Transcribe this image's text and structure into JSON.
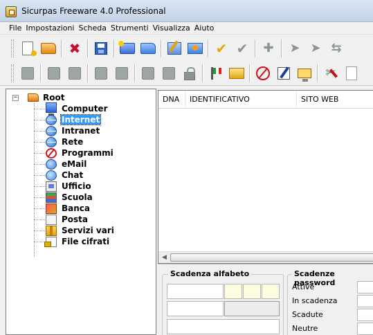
{
  "window": {
    "title": "Sicurpas Freeware 4.0 Professional"
  },
  "menu": {
    "items": [
      "File",
      "Impostazioni",
      "Scheda",
      "Strumenti",
      "Visualizza",
      "Aiuto"
    ]
  },
  "toolbar1": {
    "icons": [
      "new-document-icon",
      "open-folder-icon",
      "delete-icon",
      "save-icon",
      "folder-star-icon",
      "folder-open-icon",
      "edit-icon",
      "folder-move-icon",
      "check-icon",
      "check-disabled-icon",
      "arrows-disabled-icon",
      "arrow-disabled-icon",
      "arrow-disabled-icon",
      "arrow-disabled-icon"
    ]
  },
  "toolbar2": {
    "icons": [
      "disabled-icon",
      "disabled-icon",
      "disabled-icon",
      "disabled-icon",
      "disabled-icon",
      "disabled-icon",
      "disabled-icon",
      "lock-disabled-icon",
      "flag-icon",
      "folder-key-icon",
      "no-entry-icon",
      "edit-pen-icon",
      "monitor-icon",
      "tools-icon",
      "blank-doc-icon"
    ]
  },
  "tree": {
    "root_label": "Root",
    "toggle": "−",
    "items": [
      {
        "label": "Computer",
        "icon": "computer-icon"
      },
      {
        "label": "Internet",
        "icon": "globe-icon",
        "selected": true
      },
      {
        "label": "Intranet",
        "icon": "globe-icon"
      },
      {
        "label": "Rete",
        "icon": "globe-icon"
      },
      {
        "label": "Programmi",
        "icon": "programs-icon"
      },
      {
        "label": "eMail",
        "icon": "email-icon"
      },
      {
        "label": "Chat",
        "icon": "chat-icon"
      },
      {
        "label": "Ufficio",
        "icon": "office-icon"
      },
      {
        "label": "Scuola",
        "icon": "school-icon"
      },
      {
        "label": "Banca",
        "icon": "bank-icon"
      },
      {
        "label": "Posta",
        "icon": "post-icon"
      },
      {
        "label": "Servizi vari",
        "icon": "misc-services-icon"
      },
      {
        "label": "File cifrati",
        "icon": "encrypted-file-icon"
      }
    ]
  },
  "list": {
    "columns": [
      "DNA",
      "IDENTIFICATIVO",
      "SITO WEB"
    ],
    "scroll_left_glyph": "◀"
  },
  "scadenza_alfabeto": {
    "title": "Scadenza alfabeto"
  },
  "scadenze_password": {
    "title": "Scadenze password",
    "labels": [
      "Attive",
      "In scadenza",
      "Scadute",
      "Neutre"
    ]
  }
}
